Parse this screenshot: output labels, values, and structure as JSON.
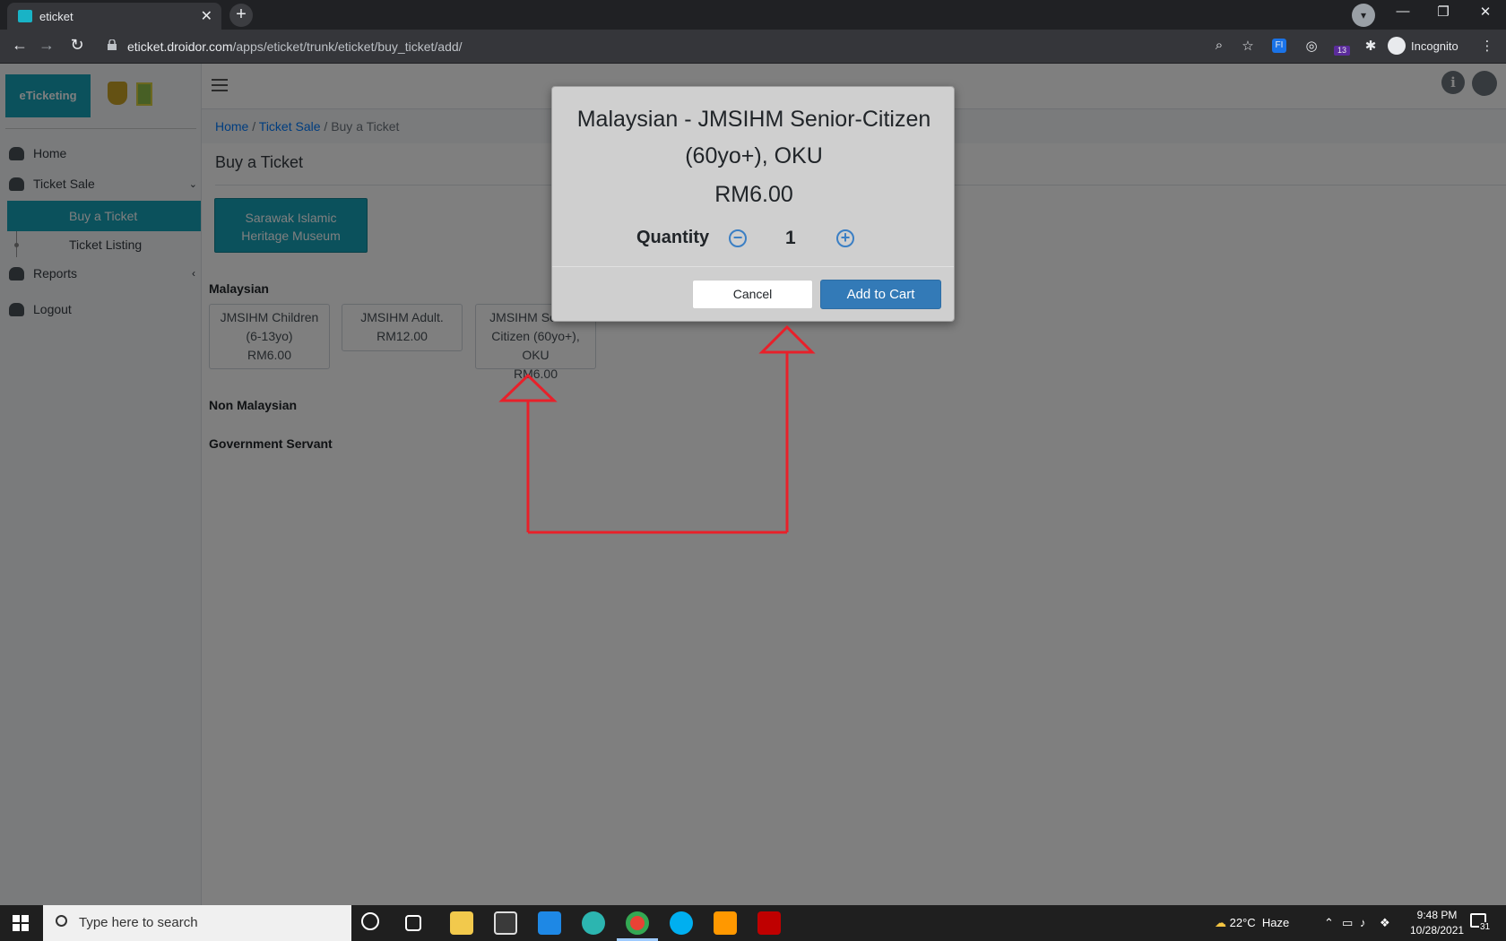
{
  "browser": {
    "tab_title": "eticket",
    "tab_close": "✕",
    "new_tab": "+",
    "url_host": "eticket.droidor.com",
    "url_path": "/apps/eticket/trunk/eticket/buy_ticket/add/",
    "incognito_label": "Incognito",
    "extension_badge": "13"
  },
  "sidebar": {
    "brand": "eTicketing",
    "items": [
      {
        "label": "Home",
        "icon": "home-icon"
      },
      {
        "label": "Ticket Sale",
        "icon": "ticket-sale-icon"
      },
      {
        "label": "Buy a Ticket"
      },
      {
        "label": "Ticket Listing"
      },
      {
        "label": "Reports",
        "icon": "reports-icon"
      },
      {
        "label": "Logout",
        "icon": "logout-icon"
      }
    ]
  },
  "breadcrumb": {
    "home": "Home",
    "sep1": " / ",
    "ticket_sale": "Ticket Sale",
    "sep2": " / ",
    "current": "Buy a Ticket"
  },
  "page": {
    "title": "Buy a Ticket",
    "museum_button": "Sarawak Islamic Heritage Museum",
    "sections": [
      "Malaysian",
      "Non Malaysian",
      "Government Servant"
    ],
    "tickets": [
      {
        "name": "JMSIHM Children (6-13yo)",
        "price": "RM6.00"
      },
      {
        "name": "JMSIHM Adult.",
        "price": "RM12.00"
      },
      {
        "name": "JMSIHM Senior-Citizen (60yo+), OKU",
        "price": "RM6.00"
      }
    ]
  },
  "modal": {
    "title": "Malaysian - JMSIHM Senior-Citizen (60yo+), OKU",
    "price": "RM6.00",
    "quantity_label": "Quantity",
    "quantity_value": "1",
    "cancel_label": "Cancel",
    "add_label": "Add to Cart"
  },
  "taskbar": {
    "search_placeholder": "Type here to search",
    "temperature": "22°C",
    "weather": "Haze",
    "time": "9:48 PM",
    "date": "10/28/2021",
    "notification_count": "31"
  },
  "colors": {
    "accent": "#17a2b8",
    "primary_button": "#337ab7",
    "annotation": "#e8202a"
  }
}
